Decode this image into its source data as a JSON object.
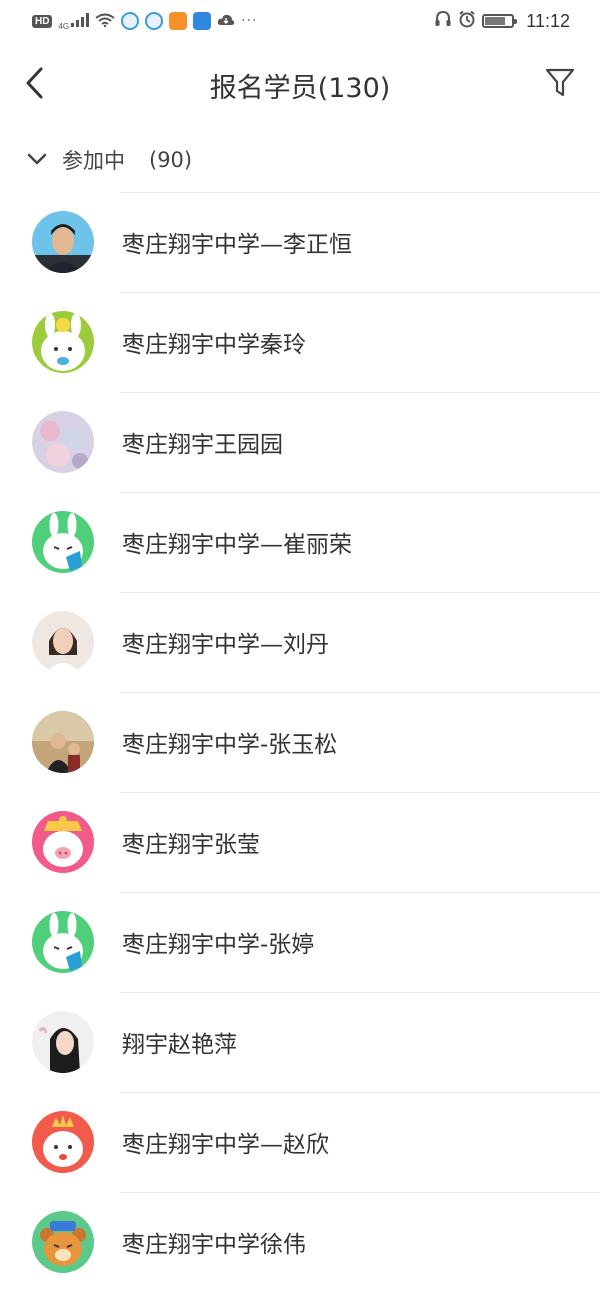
{
  "status_bar": {
    "hd_label": "HD",
    "network_label": "4G",
    "dots": "···",
    "time": "11:12",
    "battery_level": 0.7
  },
  "header": {
    "title": "报名学员(130)",
    "back_icon": "chevron-left-icon",
    "filter_icon": "filter-icon"
  },
  "section": {
    "label": "参加中",
    "count": "(90)",
    "icon": "chevron-down-icon"
  },
  "members": [
    {
      "name": "枣庄翔宇中学—李正恒",
      "avatar": "photo-man",
      "avatar_color": "#6ec3e8"
    },
    {
      "name": "枣庄翔宇中学秦玲",
      "avatar": "bunny-chick",
      "avatar_color": "#9ccc3c"
    },
    {
      "name": "枣庄翔宇王园园",
      "avatar": "photo-blossom",
      "avatar_color": "#d8d0e4"
    },
    {
      "name": "枣庄翔宇中学—崔丽荣",
      "avatar": "bunny-green",
      "avatar_color": "#4fcf7a"
    },
    {
      "name": "枣庄翔宇中学—刘丹",
      "avatar": "photo-woman",
      "avatar_color": "#efe8e2"
    },
    {
      "name": "枣庄翔宇中学-张玉松",
      "avatar": "photo-outdoor",
      "avatar_color": "#c3a579"
    },
    {
      "name": "枣庄翔宇张莹",
      "avatar": "pig-pink",
      "avatar_color": "#f25a8a"
    },
    {
      "name": "枣庄翔宇中学-张婷",
      "avatar": "bunny-green",
      "avatar_color": "#4fcf7a"
    },
    {
      "name": "翔宇赵艳萍",
      "avatar": "photo-girl",
      "avatar_color": "#f0f0f0"
    },
    {
      "name": "枣庄翔宇中学—赵欣",
      "avatar": "cat-crown",
      "avatar_color": "#f25b4c"
    },
    {
      "name": "枣庄翔宇中学徐伟",
      "avatar": "bear-orange",
      "avatar_color": "#5cc98a"
    }
  ]
}
